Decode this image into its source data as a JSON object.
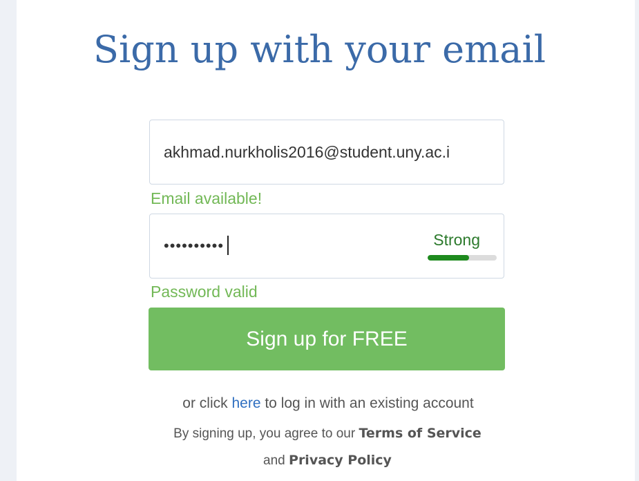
{
  "title": "Sign up with your email",
  "email": {
    "value": "akhmad.nurkholis2016@student.uny.ac.i",
    "status": "Email available!"
  },
  "password": {
    "value": "••••••••••",
    "strength_label": "Strong",
    "strength_fraction": 0.6,
    "status": "Password valid"
  },
  "signup_button": "Sign up for FREE",
  "login": {
    "prefix": "or click ",
    "link": "here",
    "suffix": " to log in with an existing account"
  },
  "terms": {
    "prefix": "By signing up, you agree to our ",
    "terms_link": "Terms of Service",
    "and_text": "and ",
    "privacy_link": "Privacy Policy"
  },
  "colors": {
    "title": "#3b6aa8",
    "success": "#72b856",
    "button": "#72bd61",
    "strength_fill": "#1e8a1e",
    "link": "#2f6fc0"
  }
}
